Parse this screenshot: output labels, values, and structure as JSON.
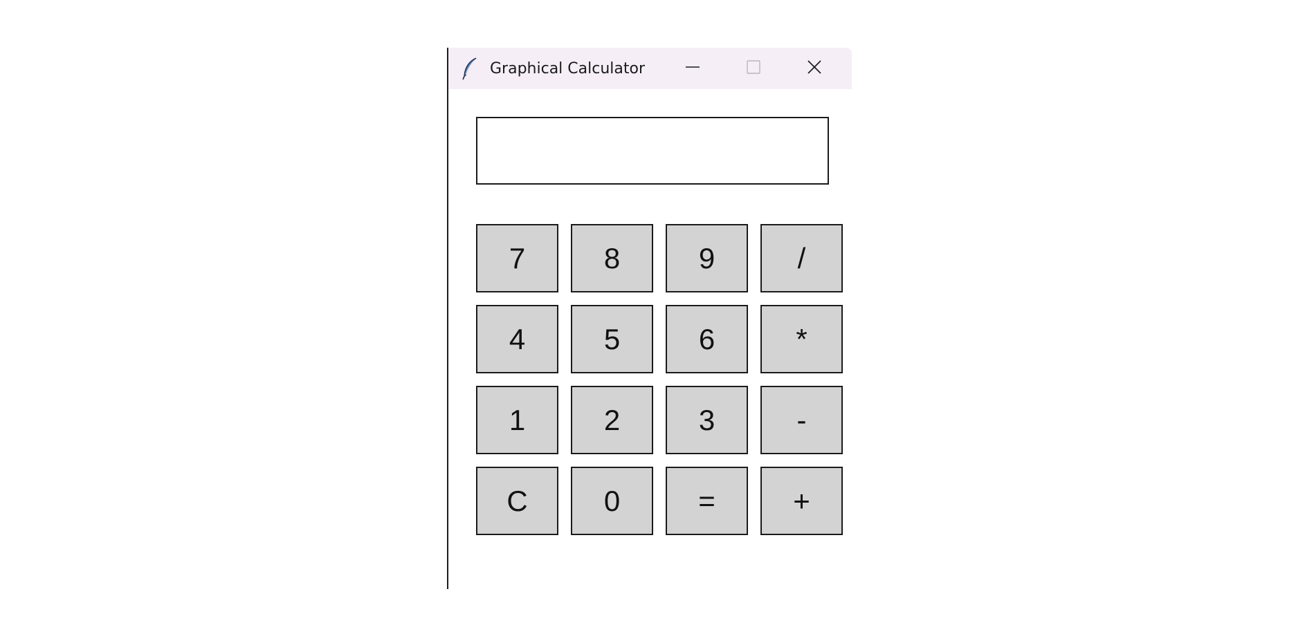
{
  "window": {
    "title": "Graphical Calculator",
    "icon": "feather-icon",
    "controls": {
      "minimize": "minimize-icon",
      "maximize": "maximize-icon",
      "close": "close-icon"
    }
  },
  "display": {
    "value": ""
  },
  "keypad": {
    "rows": [
      [
        "7",
        "8",
        "9",
        "/"
      ],
      [
        "4",
        "5",
        "6",
        "*"
      ],
      [
        "1",
        "2",
        "3",
        "-"
      ],
      [
        "C",
        "0",
        "=",
        "+"
      ]
    ]
  },
  "colors": {
    "titlebar": "#f5eef7",
    "key_background": "#d3d3d3",
    "border": "#1a1a1a"
  }
}
